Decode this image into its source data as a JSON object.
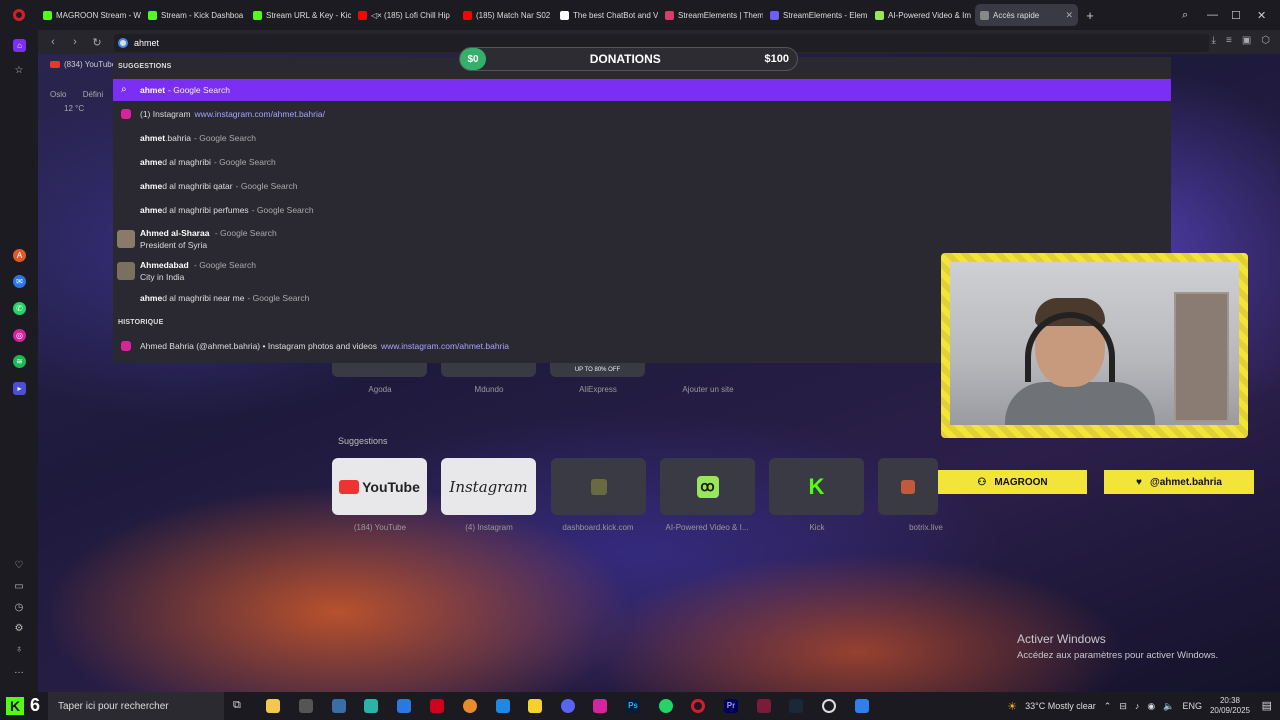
{
  "tabs": [
    {
      "label": "MAGROON Stream - W",
      "color": "#53fc18"
    },
    {
      "label": "Stream - Kick Dashboa",
      "color": "#53fc18"
    },
    {
      "label": "Stream URL & Key - Kic",
      "color": "#53fc18"
    },
    {
      "label": "◁× (185) Lofi Chill Hip",
      "color": "#ff0000"
    },
    {
      "label": "(185) Match Nar S02 🔥",
      "color": "#ff0000"
    },
    {
      "label": "The best ChatBot and V",
      "color": "#ffffff"
    },
    {
      "label": "StreamElements | Them",
      "color": "#d63d69"
    },
    {
      "label": "StreamElements - Elem",
      "color": "#6d5cff"
    },
    {
      "label": "AI-Powered Video & Im",
      "color": "#9ae65a"
    },
    {
      "label": "Accès rapide",
      "color": "#888888"
    }
  ],
  "address_bar": {
    "value": "ahmet"
  },
  "bookmark": {
    "label": "(834) YouTube"
  },
  "weather": {
    "city": "Oslo",
    "define": "Défini",
    "temp": "12 °C"
  },
  "suggestions_header": "SUGGESTIONS",
  "suggestions": [
    {
      "bold": "ahmet",
      "rest": "",
      "sub": "- Google Search",
      "url": ""
    },
    {
      "bold": "",
      "rest": "(1) Instagram",
      "sub": "",
      "url": "www.instagram.com/ahmet.bahria/"
    },
    {
      "bold": "ahmet",
      "rest": ".bahria",
      "sub": "- Google Search",
      "url": ""
    },
    {
      "bold": "ahme",
      "rest": "d al maghribi",
      "sub": "- Google Search",
      "url": ""
    },
    {
      "bold": "ahme",
      "rest": "d al maghribi qatar",
      "sub": "- Google Search",
      "url": ""
    },
    {
      "bold": "ahme",
      "rest": "d al maghribi perfumes",
      "sub": "- Google Search",
      "url": ""
    }
  ],
  "entities": [
    {
      "name": "Ahmed al-Sharaa",
      "sub": "- Google Search",
      "desc": "President of Syria"
    },
    {
      "name": "Ahmedabad",
      "sub": "- Google Search",
      "desc": "City in India"
    }
  ],
  "last_suggestion": {
    "bold": "ahme",
    "rest": "d al maghribi near me",
    "sub": "- Google Search"
  },
  "history_header": "HISTORIQUE",
  "history": {
    "title": "Ahmed Bahria (@ahmet.bahria) • Instagram photos and videos",
    "url": "www.instagram.com/ahmet.bahria"
  },
  "donation": {
    "current": "$0",
    "title": "DONATIONS",
    "goal": "$100"
  },
  "top_dials": [
    {
      "label": "Agoda"
    },
    {
      "label": "Mdundo"
    },
    {
      "label": "AliExpress",
      "badge": "UP TO 80% OFF"
    },
    {
      "label": "Ajouter un site"
    }
  ],
  "speed_dial_title": "Suggestions",
  "speed_dials": [
    {
      "label": "(184) YouTube",
      "text": "YouTube"
    },
    {
      "label": "(4) Instagram",
      "text": "Instagram"
    },
    {
      "label": "dashboard.kick.com",
      "text": ""
    },
    {
      "label": "AI-Powered Video & I...",
      "text": ""
    },
    {
      "label": "Kick",
      "text": ""
    },
    {
      "label": "botrix.live",
      "text": ""
    }
  ],
  "nametags": {
    "channel": "MAGROON",
    "instagram": "@ahmet.bahria"
  },
  "activate_windows": {
    "title": "Activer Windows",
    "subtitle": "Accédez aux paramètres pour activer Windows."
  },
  "taskbar": {
    "search_placeholder": "Taper ici pour rechercher",
    "weather": "33°C  Mostly clear",
    "lang": "ENG",
    "time": "20:38",
    "date": "20/09/2025"
  }
}
